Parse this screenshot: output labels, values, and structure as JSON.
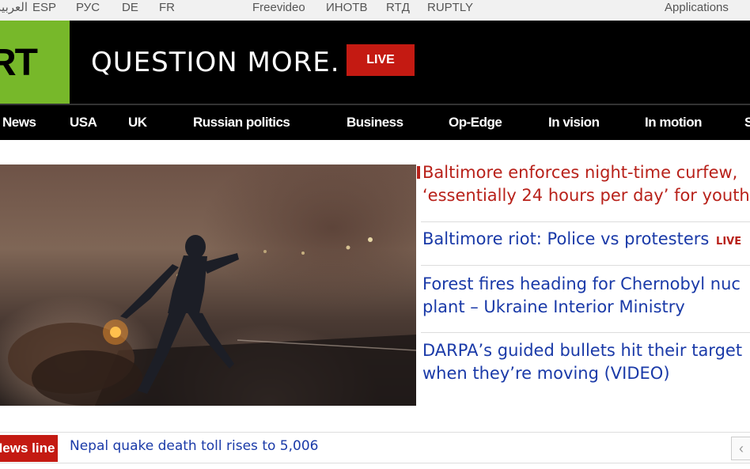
{
  "topbar": {
    "lang_ar": "العربية",
    "lang_esp": "ESP",
    "lang_rus": "РУС",
    "lang_de": "DE",
    "lang_fr": "FR",
    "freevideo": "Freevideo",
    "inotv": "ИНОТВ",
    "rtd": "RTД",
    "ruptly": "RUPTLY",
    "applications": "Applications"
  },
  "header": {
    "logo_text": "RT",
    "slogan": "QUESTION MORE.",
    "live_label": "LIVE"
  },
  "nav": {
    "items": [
      "News",
      "USA",
      "UK",
      "Russian politics",
      "Business",
      "Op-Edge",
      "In vision",
      "In motion",
      "S"
    ]
  },
  "headlines": {
    "main_line1": "Baltimore enforces night-time curfew,",
    "main_line2": "‘essentially 24 hours per day’ for youth",
    "h2": "Baltimore riot: Police vs protesters",
    "h2_badge": "LIVE",
    "h3_line1": "Forest fires heading for Chernobyl nuc",
    "h3_line2": "plant – Ukraine Interior Ministry",
    "h4_line1": "DARPA’s guided bullets hit their target",
    "h4_line2": "when they’re moving (VIDEO)"
  },
  "newsline": {
    "label": "News line",
    "text": "Nepal quake death toll rises to 5,006",
    "arrow": "‹"
  },
  "colors": {
    "brand_green": "#77b82a",
    "live_red": "#c41a12",
    "link_blue": "#1a3aa8",
    "headline_red": "#b8211a"
  }
}
